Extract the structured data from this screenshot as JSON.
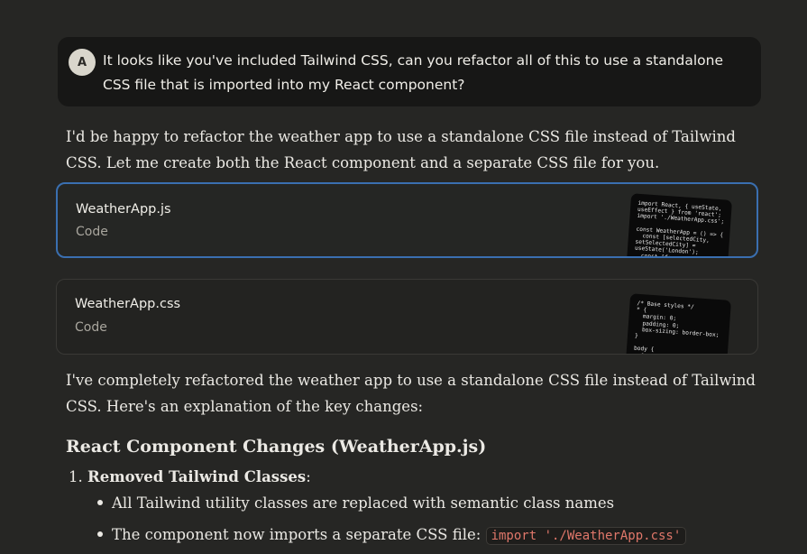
{
  "user_message": {
    "avatar_initial": "A",
    "text": "It looks like you've included Tailwind CSS, can you refactor all of this to use a standalone CSS file that is imported into my React component?"
  },
  "response": {
    "intro": "I'd be happy to refactor the weather app to use a standalone CSS file instead of Tailwind CSS. Let me create both the React component and a separate CSS file for you.",
    "artifacts": [
      {
        "title": "WeatherApp.js",
        "type": "Code",
        "preview": "import React, { useState,\nuseEffect } from 'react';\nimport './WeatherApp.css';\n\nconst WeatherApp = () => {\n  const [selectedCity,\nsetSelectedCity] =\nuseState('London');\n  const [forecast,\nsetForecast] ="
      },
      {
        "title": "WeatherApp.css",
        "type": "Code",
        "preview": "/* Base styles */\n* {\n  margin: 0;\n  padding: 0;\n  box-sizing: border-box;\n}\n\nbody {\n  font-family: -apple-\nsystem, BlinkMac"
      }
    ],
    "summary": "I've completely refactored the weather app to use a standalone CSS file instead of Tailwind CSS. Here's an explanation of the key changes:",
    "heading": "React Component Changes (WeatherApp.js)",
    "list_item_number": "1.",
    "list_item_title": "Removed Tailwind Classes",
    "list_item_colon": ":",
    "bullets": [
      {
        "text": "All Tailwind utility classes are replaced with semantic class names"
      },
      {
        "text": "The component now imports a separate CSS file:",
        "code": "import './WeatherApp.css'"
      }
    ]
  }
}
